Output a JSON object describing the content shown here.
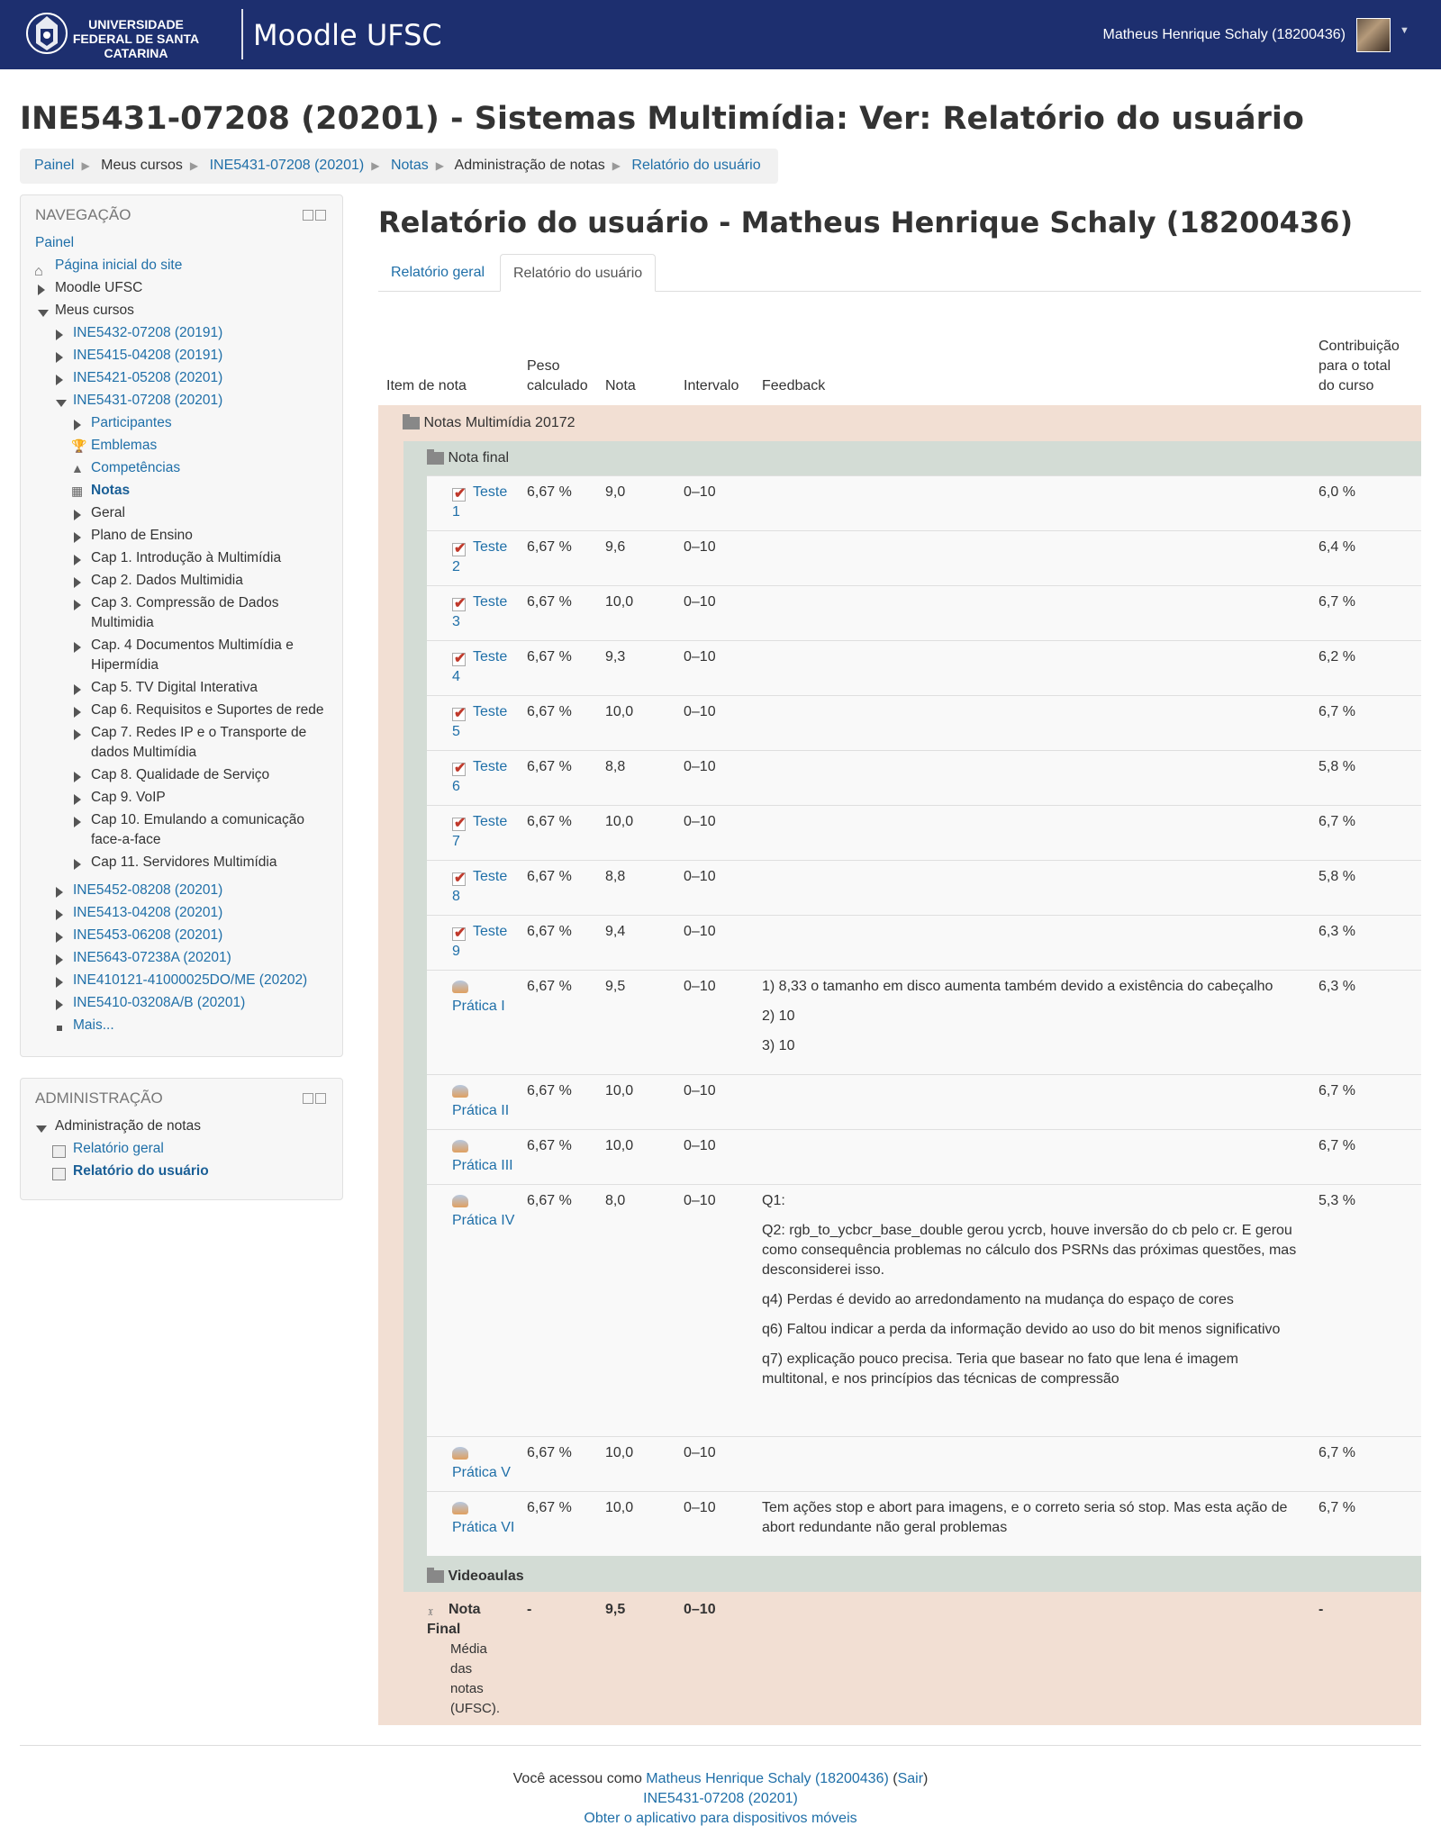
{
  "header": {
    "university": "UNIVERSIDADE FEDERAL DE SANTA CATARINA",
    "site_name": "Moodle UFSC",
    "user_name": "Matheus Henrique Schaly (18200436)"
  },
  "page_title": "INE5431-07208 (20201) - Sistemas Multimídia: Ver: Relatório do usuário",
  "breadcrumb": [
    "Painel",
    "Meus cursos",
    "INE5431-07208 (20201)",
    "Notas",
    "Administração de notas",
    "Relatório do usuário"
  ],
  "navigation": {
    "title": "NAVEGAÇÃO",
    "dashboard": "Painel",
    "site_home": "Página inicial do site",
    "moodle": "Moodle UFSC",
    "my_courses": "Meus cursos",
    "courses_top": [
      "INE5432-07208 (20191)",
      "INE5415-04208 (20191)",
      "INE5421-05208 (20201)",
      "INE5431-07208 (20201)"
    ],
    "current_course_items": [
      "Participantes",
      "Emblemas",
      "Competências",
      "Notas"
    ],
    "sections": [
      "Geral",
      "Plano de Ensino",
      "Cap 1. Introdução à Multimídia",
      "Cap 2. Dados Multimidia",
      "Cap 3. Compressão de Dados",
      "Multimidia",
      "Cap. 4 Documentos Multimídia e",
      "Hipermídia",
      "Cap 5. TV Digital Interativa",
      "Cap 6. Requisitos e Suportes de rede",
      "Cap 7. Redes IP e o Transporte de",
      "dados Multimídia",
      "Cap 8. Qualidade de Serviço",
      "Cap 9. VoIP",
      "Cap 10. Emulando a comunicação",
      "face-a-face",
      "Cap 11. Servidores Multimídia"
    ],
    "courses_bottom": [
      "INE5452-08208 (20201)",
      "INE5413-04208 (20201)",
      "INE5453-06208 (20201)",
      "INE5643-07238A (20201)",
      "INE410121-41000025DO/ME (20202)",
      "INE5410-03208A/B (20201)"
    ],
    "more": "Mais..."
  },
  "administration": {
    "title": "ADMINISTRAÇÃO",
    "grades_admin": "Administração de notas",
    "general_report": "Relatório geral",
    "user_report": "Relatório do usuário"
  },
  "report": {
    "title": "Relatório do usuário - Matheus Henrique Schaly (18200436)",
    "tabs": [
      "Relatório geral",
      "Relatório do usuário"
    ],
    "columns": {
      "item": "Item de nota",
      "weight_1": "Peso",
      "weight_2": "calculado",
      "grade": "Nota",
      "range": "Intervalo",
      "feedback": "Feedback",
      "contrib_1": "Contribuição",
      "contrib_2": "para o total",
      "contrib_3": "do curso"
    },
    "category": "Notas Multimídia 20172",
    "subcategory": "Nota final",
    "quiz_word": "Teste",
    "rows": [
      {
        "n": "1",
        "weight": "6,67 %",
        "grade": "9,0",
        "range": "0–10",
        "contrib": "6,0 %"
      },
      {
        "n": "2",
        "weight": "6,67 %",
        "grade": "9,6",
        "range": "0–10",
        "contrib": "6,4 %"
      },
      {
        "n": "3",
        "weight": "6,67 %",
        "grade": "10,0",
        "range": "0–10",
        "contrib": "6,7 %"
      },
      {
        "n": "4",
        "weight": "6,67 %",
        "grade": "9,3",
        "range": "0–10",
        "contrib": "6,2 %"
      },
      {
        "n": "5",
        "weight": "6,67 %",
        "grade": "10,0",
        "range": "0–10",
        "contrib": "6,7 %"
      },
      {
        "n": "6",
        "weight": "6,67 %",
        "grade": "8,8",
        "range": "0–10",
        "contrib": "5,8 %"
      },
      {
        "n": "7",
        "weight": "6,67 %",
        "grade": "10,0",
        "range": "0–10",
        "contrib": "6,7 %"
      },
      {
        "n": "8",
        "weight": "6,67 %",
        "grade": "8,8",
        "range": "0–10",
        "contrib": "5,8 %"
      },
      {
        "n": "9",
        "weight": "6,67 %",
        "grade": "9,4",
        "range": "0–10",
        "contrib": "6,3 %"
      }
    ],
    "practicals": [
      {
        "name": "Prática I",
        "weight": "6,67 %",
        "grade": "9,5",
        "range": "0–10",
        "contrib": "6,3 %",
        "feedback": [
          "1) 8,33 o tamanho em disco aumenta também devido a existência do cabeçalho",
          "2) 10",
          "3) 10"
        ]
      },
      {
        "name": "Prática II",
        "weight": "6,67 %",
        "grade": "10,0",
        "range": "0–10",
        "contrib": "6,7 %",
        "feedback": []
      },
      {
        "name": "Prática III",
        "weight": "6,67 %",
        "grade": "10,0",
        "range": "0–10",
        "contrib": "6,7 %",
        "feedback": []
      },
      {
        "name": "Prática IV",
        "weight": "6,67 %",
        "grade": "8,0",
        "range": "0–10",
        "contrib": "5,3 %",
        "feedback": [
          "Q1:",
          "Q2: rgb_to_ycbcr_base_double gerou ycrcb, houve inversão do cb pelo cr. E gerou como consequência problemas no cálculo dos PSRNs das próximas questões, mas desconsiderei isso.",
          "q4) Perdas é devido ao arredondamento na mudança do espaço de cores",
          "q6) Faltou indicar a perda da informação devido ao uso do bit menos significativo",
          "q7) explicação pouco precisa. Teria que basear  no fato que lena é imagem multitonal, e nos princípios das técnicas de compressão"
        ]
      },
      {
        "name": "Prática V",
        "weight": "6,67 %",
        "grade": "10,0",
        "range": "0–10",
        "contrib": "6,7 %",
        "feedback": []
      },
      {
        "name": "Prática VI",
        "weight": "6,67 %",
        "grade": "10,0",
        "range": "0–10",
        "contrib": "6,7 %",
        "feedback": [
          "Tem ações stop e abort para imagens, e o correto seria só stop. Mas esta ação de abort redundante não geral problemas"
        ]
      }
    ],
    "videoaulas": "Videoaulas",
    "final": {
      "label_1": "Nota",
      "label_2": "Final",
      "desc": [
        "Média",
        "das",
        "notas",
        "(UFSC)."
      ],
      "weight": "-",
      "grade": "9,5",
      "range": "0–10",
      "contrib": "-"
    }
  },
  "footer": {
    "logged_as": "Você acessou como",
    "user": "Matheus Henrique Schaly (18200436)",
    "logout": "Sair",
    "course": "INE5431-07208 (20201)",
    "mobile": "Obter o aplicativo para dispositivos móveis"
  }
}
